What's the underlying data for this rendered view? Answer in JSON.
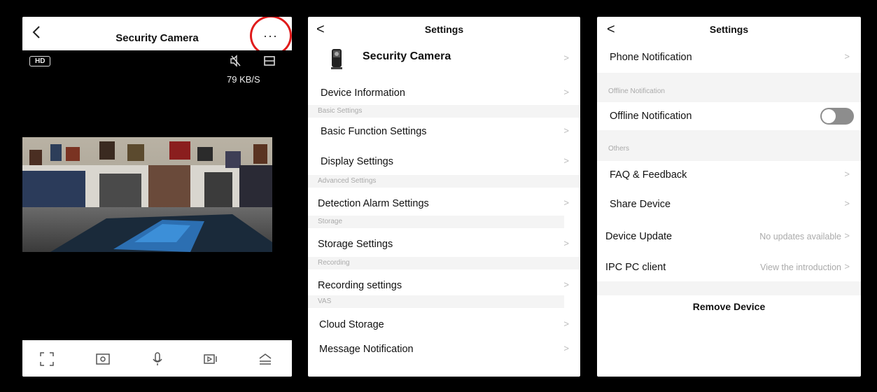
{
  "camera_view": {
    "back_icon": "chevron-left-icon",
    "title": "Security Camera",
    "more_icon": "more-dots-icon",
    "more_label": "···",
    "hd_label": "HD",
    "speed": "79 KB/S",
    "toolbar_icons": [
      "fullscreen-icon",
      "screenshot-icon",
      "microphone-icon",
      "record-icon",
      "expand-icon"
    ]
  },
  "settings_page_1": {
    "back": "<",
    "title": "Settings",
    "device_name": "Security Camera",
    "rows": {
      "device_information": "Device Information",
      "basic_settings_section": "Basic Settings",
      "basic_function_settings": "Basic Function Settings",
      "display_settings": "Display Settings",
      "advanced_settings_section": "Advanced Settings",
      "detection_alarm_settings": "Detection Alarm Settings",
      "storage_section": "Storage",
      "storage_settings": "Storage Settings",
      "recording_section": "Recording",
      "recording_settings": "Recording settings",
      "vas_section": "VAS",
      "cloud_storage": "Cloud Storage",
      "message_notification": "Message Notification"
    },
    "chevron": ">"
  },
  "settings_page_2": {
    "back": "<",
    "title": "Settings",
    "rows": {
      "phone_notification": "Phone Notification",
      "offline_section": "Offline Notification",
      "offline_notification": "Offline Notification",
      "offline_toggle_on": false,
      "others_section": "Others",
      "faq_feedback": "FAQ & Feedback",
      "share_device": "Share Device",
      "device_update": "Device Update",
      "device_update_value": "No updates available",
      "ipc_pc_client": "IPC PC client",
      "ipc_pc_client_value": "View the introduction"
    },
    "chevron": ">",
    "remove_device": "Remove Device"
  },
  "colors": {
    "highlight_circle": "#e01b1b",
    "toggle_off": "#8d8d8d"
  }
}
